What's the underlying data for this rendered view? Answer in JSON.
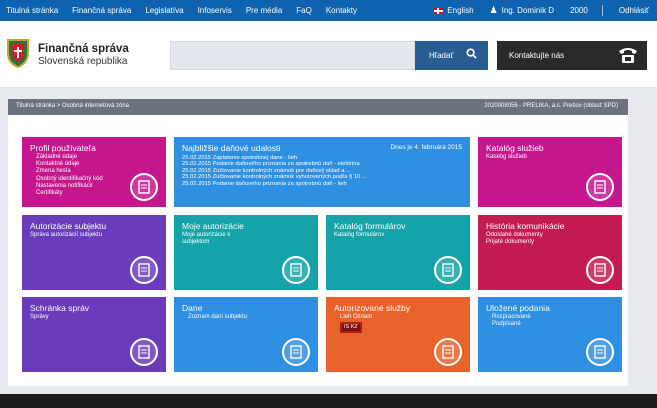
{
  "topnav": {
    "items": [
      "Titulná stránka",
      "Finančná správa",
      "Legislatíva",
      "Infoservis",
      "Pre média",
      "FaQ",
      "Kontakty"
    ],
    "language": "English",
    "user": "Ing. Dominik D",
    "timer": "2000",
    "logout": "Odhlásiť"
  },
  "header": {
    "brand_line1": "Finančná správa",
    "brand_line2": "Slovenská republika",
    "search_button": "Hľadať",
    "contact_button": "Kontaktujte nás"
  },
  "breadcrumb": {
    "path": "Titulná stránka > Osobná internetová zóna",
    "info": "2020008056 - PRELIKA, a.s. Prešov (oblasť SPD)"
  },
  "tiles": {
    "profil": {
      "title": "Profil používateľa",
      "lines": [
        "Základné údaje",
        "Kontaktné údaje",
        "Zmena hesla",
        "Osobný identifikačný kód",
        "Nastavenia notifikácií",
        "Certifikáty"
      ]
    },
    "udalosti": {
      "title": "Najbližšie daňové udalosti",
      "date": "Dnes je 4. februára 2015",
      "lines": [
        "25.02.2015 Zaplatenie spotrebnej dane - lieh",
        "25.02.2015 Podanie daňového priznania za spotrebnú daň - elektrina",
        "25.02.2015 Zúčtovanie kontrolných známok pre daňový sklad a ...",
        "25.02.2015 Zúčtovanie kontrolných známok vyhotovených podľa § 10 ...",
        "25.02.2015 Podanie daňového priznania za spotrebnú daň - lieh"
      ]
    },
    "katalog_sluzieb": {
      "title": "Katalóg služieb",
      "lines": [
        "Katalóg služieb"
      ]
    },
    "autorizacie_subjektu": {
      "title": "Autorizácie subjektu",
      "lines": [
        "Správa autorizácií subjektu"
      ]
    },
    "moje_autorizacie": {
      "title": "Moje autorizácie",
      "lines": [
        "Moje autorizácie k",
        "subjektom"
      ]
    },
    "katalog_formularov": {
      "title": "Katalóg formulárov",
      "lines": [
        "Katalóg formulárov"
      ]
    },
    "historia": {
      "title": "História komunikácie",
      "lines": [
        "Odoslané dokumenty",
        "Prijaté dokumenty"
      ]
    },
    "schranka": {
      "title": "Schránka správ",
      "lines": [
        "Správy"
      ]
    },
    "dane": {
      "title": "Dane",
      "lines": [
        "Zoznam daní subjektu"
      ]
    },
    "autorizovane": {
      "title": "Autorizované služby",
      "line1": "Lieh Oznam",
      "line2": "IS KZ"
    },
    "ulozene": {
      "title": "Uložené podania",
      "lines": [
        "Rozpracované",
        "Podpísané"
      ]
    }
  },
  "colors": {
    "topbar": "#0d63b0",
    "magenta": "#c6168d",
    "blue": "#2f8fe0",
    "purple": "#6a3cbc",
    "teal": "#14a3a8",
    "crimson": "#c41c4f",
    "orange": "#e8622b"
  }
}
